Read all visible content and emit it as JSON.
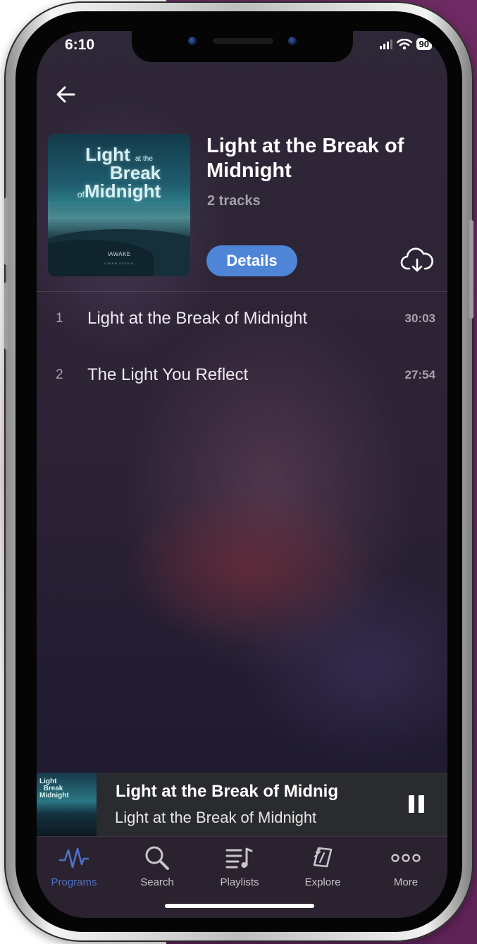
{
  "status_bar": {
    "time": "6:10",
    "battery": "90"
  },
  "header": {
    "back_icon": "arrow-left-icon"
  },
  "album": {
    "cover_title_line1": "Light",
    "cover_title_line1_small": "at the",
    "cover_title_line2": "Break",
    "cover_title_line3_small": "of",
    "cover_title_line3": "Midnight",
    "cover_brand": "IAWAKE",
    "cover_brand_sub": "LOREM STUDIO",
    "title": "Light at the Break of Midnight",
    "track_count": "2 tracks",
    "details_label": "Details",
    "download_icon": "cloud-download-icon"
  },
  "tracks": [
    {
      "number": "1",
      "title": "Light at the Break of Midnight",
      "duration": "30:03"
    },
    {
      "number": "2",
      "title": "The Light You Reflect",
      "duration": "27:54"
    }
  ],
  "mini_player": {
    "title": "Light at the Break of Midnig",
    "subtitle": "Light at the Break of Midnight",
    "pause_icon": "pause-icon"
  },
  "tabbar": {
    "items": [
      {
        "label": "Programs",
        "icon": "waveform-icon",
        "active": true
      },
      {
        "label": "Search",
        "icon": "search-icon",
        "active": false
      },
      {
        "label": "Playlists",
        "icon": "playlist-icon",
        "active": false
      },
      {
        "label": "Explore",
        "icon": "cards-icon",
        "active": false
      },
      {
        "label": "More",
        "icon": "more-dots-icon",
        "active": false
      }
    ]
  },
  "colors": {
    "accent": "#4f85d6",
    "active_tab": "#4f6fc6",
    "background_purple": "#6e2a63"
  }
}
